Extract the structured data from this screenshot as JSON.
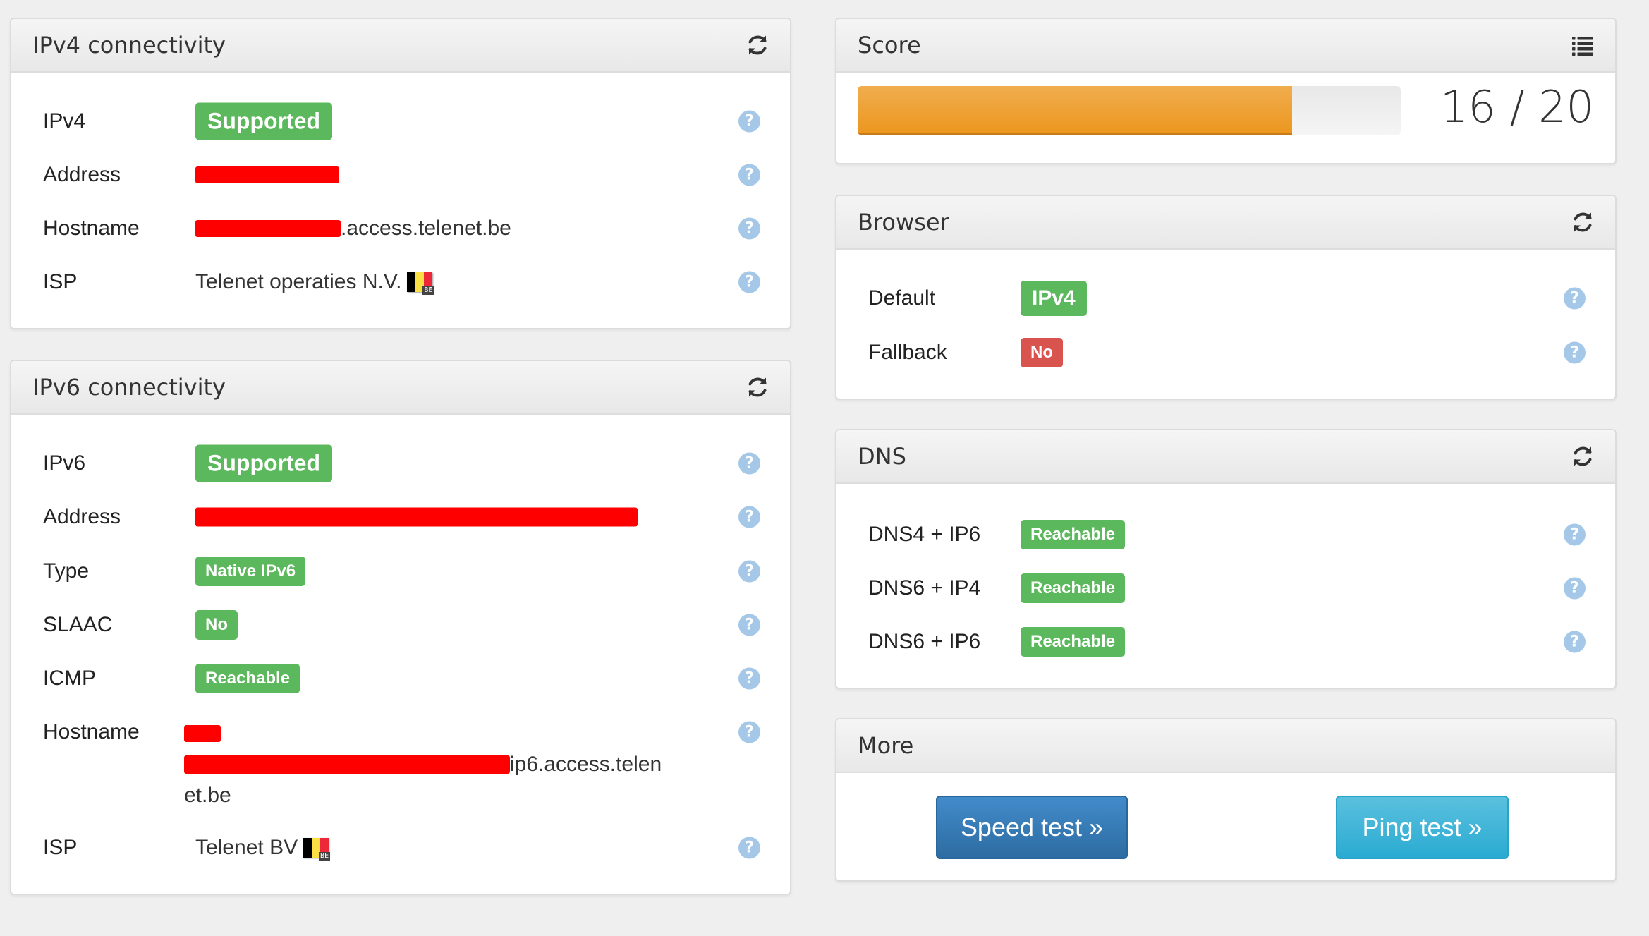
{
  "colors": {
    "success": "#5cb85c",
    "danger": "#d9534f",
    "warning": "#f0ad4e",
    "primary": "#428bca",
    "info": "#5bc0de",
    "help": "#a6c8e8",
    "redaction": "#ff0000"
  },
  "ipv4": {
    "title": "IPv4 connectivity",
    "refresh_icon": "refresh-icon",
    "rows": [
      {
        "label": "IPv4",
        "value": "Supported",
        "type": "badge"
      },
      {
        "label": "Address",
        "value": "[redacted]",
        "type": "redacted"
      },
      {
        "label": "Hostname",
        "value_suffix": ".access.telenet.be",
        "type": "redacted-hostname"
      },
      {
        "label": "ISP",
        "value": "Telenet operaties N.V.",
        "flag": "BE",
        "type": "isp"
      }
    ]
  },
  "ipv6": {
    "title": "IPv6 connectivity",
    "refresh_icon": "refresh-icon",
    "rows": [
      {
        "label": "IPv6",
        "value": "Supported",
        "type": "badge"
      },
      {
        "label": "Address",
        "value": "[redacted]",
        "type": "redacted"
      },
      {
        "label": "Type",
        "value": "Native IPv6",
        "type": "badge"
      },
      {
        "label": "SLAAC",
        "value": "No",
        "type": "badge"
      },
      {
        "label": "ICMP",
        "value": "Reachable",
        "type": "badge"
      },
      {
        "label": "Hostname",
        "value_suffix_line1": "ip6.access.telen",
        "value_line2": "et.be",
        "type": "redacted-hostname"
      },
      {
        "label": "ISP",
        "value": "Telenet BV",
        "flag": "BE",
        "type": "isp"
      }
    ]
  },
  "score": {
    "title": "Score",
    "list_icon": "list-icon",
    "value": 16,
    "max": 20,
    "fraction": 0.8,
    "text": "16 / 20"
  },
  "browser": {
    "title": "Browser",
    "refresh_icon": "refresh-icon",
    "rows": [
      {
        "label": "Default",
        "value": "IPv4",
        "status": "success"
      },
      {
        "label": "Fallback",
        "value": "No",
        "status": "danger"
      }
    ]
  },
  "dns": {
    "title": "DNS",
    "refresh_icon": "refresh-icon",
    "rows": [
      {
        "label": "DNS4 + IP6",
        "value": "Reachable",
        "status": "success"
      },
      {
        "label": "DNS6 + IP4",
        "value": "Reachable",
        "status": "success"
      },
      {
        "label": "DNS6 + IP6",
        "value": "Reachable",
        "status": "success"
      }
    ]
  },
  "more": {
    "title": "More",
    "speed_test": "Speed test »",
    "ping_test": "Ping test »"
  },
  "help_glyph": "?",
  "flag_code": "BE"
}
